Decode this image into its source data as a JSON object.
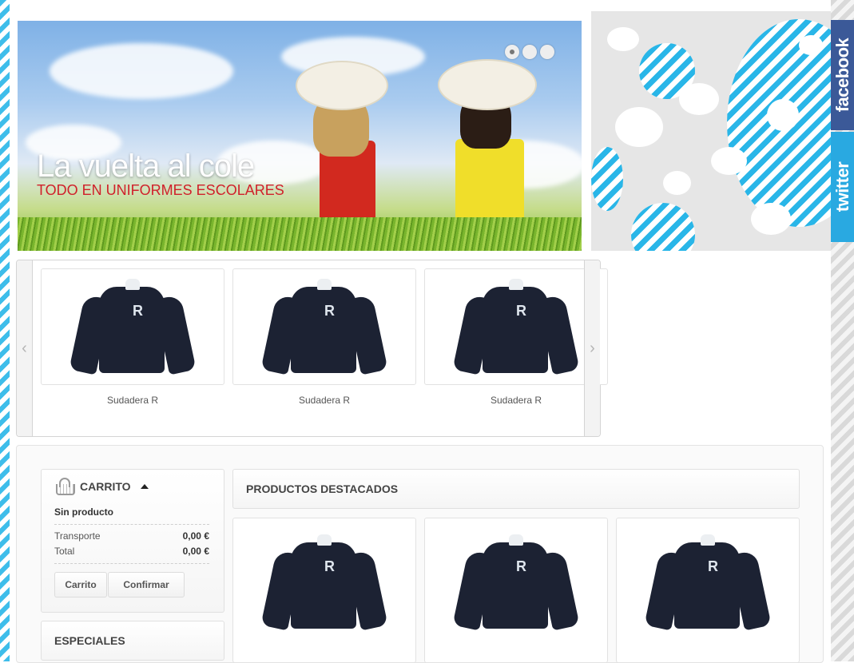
{
  "hero": {
    "title": "La  vuelta al cole",
    "subtitle": "TODO EN UNIFORMES ESCOLARES",
    "slide_count": 3,
    "active_slide": 1
  },
  "social": {
    "facebook": "facebook",
    "twitter": "twitter"
  },
  "carousel": {
    "prev_icon": "chevron-left-icon",
    "next_icon": "chevron-right-icon",
    "items": [
      {
        "name": "Sudadera R"
      },
      {
        "name": "Sudadera R"
      },
      {
        "name": "Sudadera R"
      }
    ]
  },
  "cart": {
    "title": "CARRITO",
    "empty_text": "Sin producto",
    "shipping_label": "Transporte",
    "shipping_value": "0,00 €",
    "total_label": "Total",
    "total_value": "0,00 €",
    "cart_button": "Carrito",
    "checkout_button": "Confirmar"
  },
  "especiales": {
    "title": "ESPECIALES"
  },
  "featured": {
    "title": "PRODUCTOS DESTACADOS",
    "product_letter": "R"
  },
  "colors": {
    "accent_red": "#d0202a",
    "facebook_blue": "#3b5998",
    "twitter_blue": "#29a9e1",
    "stripe_blue": "#29b6e8"
  }
}
